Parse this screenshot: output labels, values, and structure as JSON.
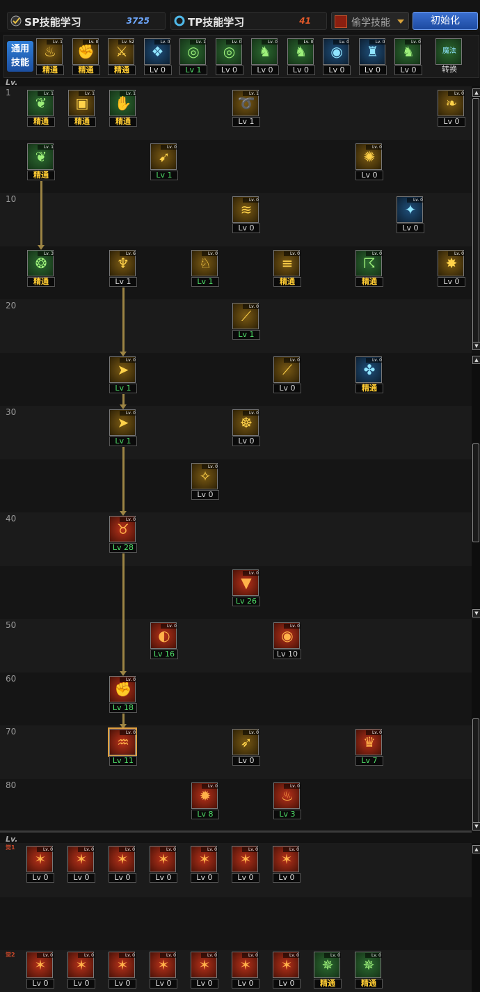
{
  "header": {
    "sp_label": "SP技能学习",
    "sp_value": "3725",
    "tp_label": "TP技能学习",
    "tp_value": "41",
    "steal_label": "偷学技能",
    "reset_label": "初始化"
  },
  "common": {
    "label_line1": "通用",
    "label_line2": "技能",
    "switch_label": "魔法",
    "switch_sub": "转换",
    "items": [
      {
        "icon": "rest-icon",
        "theme": "gold",
        "tag": "精通",
        "tagType": "m",
        "mini": "Lv. 1"
      },
      {
        "icon": "flame-fist-icon",
        "theme": "gold",
        "tag": "精通",
        "tagType": "m",
        "mini": "Lv. 0"
      },
      {
        "icon": "weapon-mastery-icon",
        "theme": "gold",
        "tag": "精通",
        "tagType": "m",
        "mini": "Lv. 52"
      },
      {
        "icon": "wing-icon",
        "theme": "blue",
        "tag": "Lv 0",
        "tagType": "n",
        "mini": "Lv. 0"
      },
      {
        "icon": "target-icon",
        "theme": "green",
        "tag": "Lv 1",
        "tagType": "g",
        "mini": "Lv. 1"
      },
      {
        "icon": "target-icon",
        "theme": "green",
        "tag": "Lv 0",
        "tagType": "n",
        "mini": "Lv. 0"
      },
      {
        "icon": "figure-icon",
        "theme": "green",
        "tag": "Lv 0",
        "tagType": "n",
        "mini": "Lv. 0"
      },
      {
        "icon": "figure-icon",
        "theme": "green",
        "tag": "Lv 0",
        "tagType": "n",
        "mini": "Lv. 0"
      },
      {
        "icon": "eye-icon",
        "theme": "blue",
        "tag": "Lv 0",
        "tagType": "n",
        "mini": "Lv. 0"
      },
      {
        "icon": "armor-icon",
        "theme": "blue",
        "tag": "Lv 0",
        "tagType": "n",
        "mini": "Lv. 0"
      },
      {
        "icon": "figure-icon",
        "theme": "green",
        "tag": "Lv 0",
        "tagType": "n",
        "mini": "Lv. 0"
      }
    ]
  },
  "tree": {
    "lv_header": "Lv.",
    "levels": [
      "1",
      "",
      "10",
      "",
      "20",
      "",
      "30",
      "",
      "40",
      "",
      "50",
      "60",
      "70",
      "80"
    ],
    "skills": [
      {
        "row": 0,
        "col": 0,
        "icon": "leaf-icon",
        "theme": "green",
        "tag": "精通",
        "tagType": "m",
        "mini": "Lv. 1"
      },
      {
        "row": 0,
        "col": 1,
        "icon": "book-icon",
        "theme": "gold",
        "tag": "精通",
        "tagType": "m",
        "mini": "Lv. 1"
      },
      {
        "row": 0,
        "col": 2,
        "icon": "claw-icon",
        "theme": "green",
        "tag": "精通",
        "tagType": "m",
        "mini": "Lv. 1"
      },
      {
        "row": 0,
        "col": 5,
        "icon": "whip-icon",
        "theme": "gold",
        "tag": "Lv 1",
        "tagType": "n",
        "mini": "Lv. 1"
      },
      {
        "row": 0,
        "col": 10,
        "icon": "dragon-icon",
        "theme": "gold",
        "tag": "Lv 0",
        "tagType": "n",
        "mini": "Lv. 0"
      },
      {
        "row": 1,
        "col": 0,
        "icon": "leaf-icon",
        "theme": "green",
        "tag": "精通",
        "tagType": "m",
        "mini": "Lv. 1"
      },
      {
        "row": 1,
        "col": 3,
        "icon": "kick-icon",
        "theme": "gold",
        "tag": "Lv 1",
        "tagType": "g",
        "mini": "Lv. 0"
      },
      {
        "row": 1,
        "col": 8,
        "icon": "spiral-icon",
        "theme": "gold",
        "tag": "Lv 0",
        "tagType": "n",
        "mini": "Lv. 0"
      },
      {
        "row": 2,
        "col": 5,
        "icon": "swirl-icon",
        "theme": "gold",
        "tag": "Lv 0",
        "tagType": "n",
        "mini": "Lv. 0"
      },
      {
        "row": 2,
        "col": 9,
        "icon": "spark-icon",
        "theme": "blue",
        "tag": "Lv 0",
        "tagType": "n",
        "mini": "Lv. 0"
      },
      {
        "row": 3,
        "col": 0,
        "icon": "drop-icon",
        "theme": "green",
        "tag": "精通",
        "tagType": "m",
        "mini": "Lv. 3"
      },
      {
        "row": 3,
        "col": 2,
        "icon": "bat-icon",
        "theme": "gold",
        "tag": "Lv 1",
        "tagType": "n",
        "mini": "Lv. 6"
      },
      {
        "row": 3,
        "col": 4,
        "icon": "horse-icon",
        "theme": "gold",
        "tag": "Lv 1",
        "tagType": "g",
        "mini": "Lv. 0"
      },
      {
        "row": 3,
        "col": 6,
        "icon": "blade-icon",
        "theme": "gold",
        "tag": "精通",
        "tagType": "m",
        "mini": "Lv. 0"
      },
      {
        "row": 3,
        "col": 8,
        "icon": "hook-icon",
        "theme": "green",
        "tag": "精通",
        "tagType": "m",
        "mini": "Lv. 0"
      },
      {
        "row": 3,
        "col": 10,
        "icon": "burst-icon",
        "theme": "gold",
        "tag": "Lv 0",
        "tagType": "n",
        "mini": "Lv. 0"
      },
      {
        "row": 4,
        "col": 5,
        "icon": "slash-icon",
        "theme": "gold",
        "tag": "Lv 1",
        "tagType": "g",
        "mini": "Lv. 0"
      },
      {
        "row": 5,
        "col": 2,
        "icon": "rush-icon",
        "theme": "gold",
        "tag": "Lv 1",
        "tagType": "g",
        "mini": "Lv. 0"
      },
      {
        "row": 5,
        "col": 6,
        "icon": "slash-icon",
        "theme": "gold",
        "tag": "Lv 0",
        "tagType": "n",
        "mini": "Lv. 0"
      },
      {
        "row": 5,
        "col": 8,
        "icon": "water-icon",
        "theme": "blue",
        "tag": "精通",
        "tagType": "m",
        "mini": "Lv. 0"
      },
      {
        "row": 6,
        "col": 2,
        "icon": "rush-icon",
        "theme": "gold",
        "tag": "Lv 1",
        "tagType": "g",
        "mini": "Lv. 0"
      },
      {
        "row": 6,
        "col": 5,
        "icon": "shell-icon",
        "theme": "gold",
        "tag": "Lv 0",
        "tagType": "n",
        "mini": "Lv. 0"
      },
      {
        "row": 7,
        "col": 4,
        "icon": "rise-icon",
        "theme": "gold",
        "tag": "Lv 0",
        "tagType": "n",
        "mini": "Lv. 0"
      },
      {
        "row": 8,
        "col": 2,
        "icon": "beast-icon",
        "theme": "red",
        "tag": "Lv 28",
        "tagType": "g",
        "mini": "Lv. 0"
      },
      {
        "row": 9,
        "col": 5,
        "icon": "jaw-icon",
        "theme": "red",
        "tag": "Lv 26",
        "tagType": "g",
        "mini": "Lv. 0"
      },
      {
        "row": 10,
        "col": 3,
        "icon": "dark-beast-icon",
        "theme": "red",
        "tag": "Lv 16",
        "tagType": "g",
        "mini": "Lv. 0"
      },
      {
        "row": 10,
        "col": 6,
        "icon": "eye-red-icon",
        "theme": "red",
        "tag": "Lv 10",
        "tagType": "n",
        "mini": "Lv. 0"
      },
      {
        "row": 11,
        "col": 2,
        "icon": "fist-icon",
        "theme": "red",
        "tag": "Lv 18",
        "tagType": "g",
        "mini": "Lv. 0"
      },
      {
        "row": 12,
        "col": 2,
        "icon": "roar-icon",
        "theme": "red",
        "tag": "Lv 11",
        "tagType": "g",
        "mini": "Lv. 0",
        "selected": true
      },
      {
        "row": 12,
        "col": 5,
        "icon": "bird-icon",
        "theme": "gold",
        "tag": "Lv 0",
        "tagType": "n",
        "mini": "Lv. 0"
      },
      {
        "row": 12,
        "col": 8,
        "icon": "dragon-head-icon",
        "theme": "red",
        "tag": "Lv 7",
        "tagType": "g",
        "mini": "Lv. 0"
      },
      {
        "row": 13,
        "col": 4,
        "icon": "explode-icon",
        "theme": "red",
        "tag": "Lv 8",
        "tagType": "g",
        "mini": "Lv. 0"
      },
      {
        "row": 13,
        "col": 6,
        "icon": "flame-wave-icon",
        "theme": "red",
        "tag": "Lv 3",
        "tagType": "g",
        "mini": "Lv. 0"
      }
    ]
  },
  "awaken": {
    "lv_header": "Lv.",
    "row1_marker": "觉1",
    "row2_marker": "觉2",
    "row1": [
      {
        "icon": "ex-claw-icon",
        "theme": "red",
        "tag": "Lv 0",
        "tagType": "n",
        "mini": "Lv. 0"
      },
      {
        "icon": "ex-claw-icon",
        "theme": "red",
        "tag": "Lv 0",
        "tagType": "n",
        "mini": "Lv. 0"
      },
      {
        "icon": "ex-claw-icon",
        "theme": "red",
        "tag": "Lv 0",
        "tagType": "n",
        "mini": "Lv. 0"
      },
      {
        "icon": "ex-claw-icon",
        "theme": "red",
        "tag": "Lv 0",
        "tagType": "n",
        "mini": "Lv. 0"
      },
      {
        "icon": "ex-claw-icon",
        "theme": "red",
        "tag": "Lv 0",
        "tagType": "n",
        "mini": "Lv. 0"
      },
      {
        "icon": "ex-claw-icon",
        "theme": "red",
        "tag": "Lv 0",
        "tagType": "n",
        "mini": "Lv. 0"
      },
      {
        "icon": "ex-claw-icon",
        "theme": "red",
        "tag": "Lv 0",
        "tagType": "n",
        "mini": "Lv. 0"
      }
    ],
    "row2": [
      {
        "icon": "ex-claw-icon",
        "theme": "red",
        "tag": "Lv 0",
        "tagType": "n",
        "mini": "Lv. 0"
      },
      {
        "icon": "ex-claw-icon",
        "theme": "red",
        "tag": "Lv 0",
        "tagType": "n",
        "mini": "Lv. 0"
      },
      {
        "icon": "ex-claw-icon",
        "theme": "red",
        "tag": "Lv 0",
        "tagType": "n",
        "mini": "Lv. 0"
      },
      {
        "icon": "ex-claw-icon",
        "theme": "red",
        "tag": "Lv 0",
        "tagType": "n",
        "mini": "Lv. 0"
      },
      {
        "icon": "ex-claw-icon",
        "theme": "red",
        "tag": "Lv 0",
        "tagType": "n",
        "mini": "Lv. 0"
      },
      {
        "icon": "ex-claw-icon",
        "theme": "red",
        "tag": "Lv 0",
        "tagType": "n",
        "mini": "Lv. 0"
      },
      {
        "icon": "ex-claw-icon",
        "theme": "red",
        "tag": "Lv 0",
        "tagType": "n",
        "mini": "Lv. 0"
      },
      {
        "icon": "ex-green-icon",
        "theme": "green",
        "tag": "精通",
        "tagType": "m",
        "mini": "Lv. 0"
      },
      {
        "icon": "ex-green-icon",
        "theme": "green",
        "tag": "精通",
        "tagType": "m",
        "mini": "Lv. 0"
      }
    ]
  }
}
